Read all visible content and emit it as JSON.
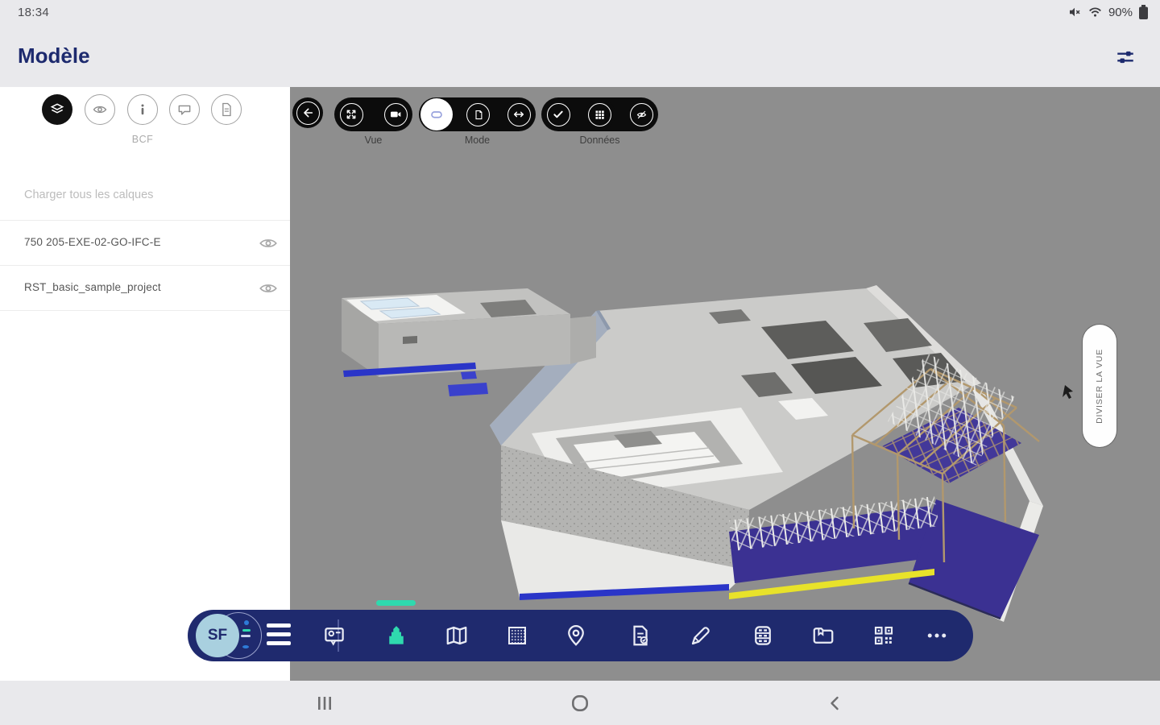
{
  "status_bar": {
    "time": "18:34",
    "battery_percent": "90%"
  },
  "header": {
    "title": "Modèle"
  },
  "sidebar": {
    "active_tab_label": "BCF",
    "load_all_label": "Charger tous les calques",
    "layers": [
      {
        "name": "750 205-EXE-02-GO-IFC-E"
      },
      {
        "name": "RST_basic_sample_project"
      }
    ]
  },
  "viewer_toolbar": {
    "vue_label": "Vue",
    "mode_label": "Mode",
    "donnees_label": "Données"
  },
  "viewer": {
    "split_view_label": "DIVISER LA VUE"
  },
  "bottom_bar": {
    "avatar_initials": "SF"
  },
  "icons": {
    "sidebar_tabs": [
      "layers-icon",
      "view-icon",
      "info-icon",
      "comment-icon",
      "document-icon"
    ],
    "toolbar": [
      "back-icon",
      "expand-icon",
      "camera-icon",
      "model-3d-icon",
      "copy-document-icon",
      "swap-horizontal-icon",
      "check-icon",
      "grid-icon",
      "eye-off-icon"
    ],
    "bottom_bar": [
      "media-viewer-icon",
      "building-icon",
      "map-icon",
      "pattern-icon",
      "location-pin-icon",
      "document-edit-icon",
      "pen-icon",
      "database-icon",
      "folder-icon",
      "qr-code-icon",
      "more-icon"
    ],
    "android_nav": [
      "recents-icon",
      "home-icon",
      "back-icon"
    ]
  },
  "colors": {
    "navy": "#1f2a6e",
    "title_navy": "#1d2a6e",
    "teal_accent": "#2fd9ae",
    "viewport_gray": "#8e8e8e",
    "model_purple": "#3b3192",
    "model_yellow": "#e8e22a",
    "model_blue": "#2a35c8",
    "skylight_blue": "#d9e9f4"
  }
}
